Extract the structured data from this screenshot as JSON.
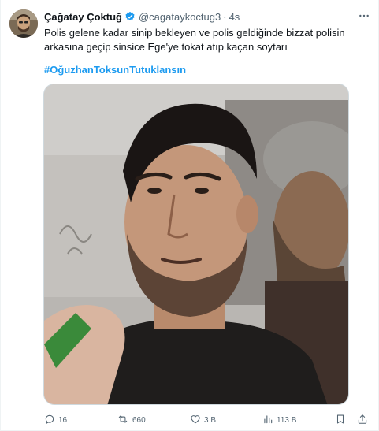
{
  "tweet": {
    "author_name": "Çağatay Çoktuğ",
    "handle": "@cagataykoctug3",
    "separator": "·",
    "time": "4s",
    "text": "Polis gelene kadar sinip bekleyen ve polis geldiğinde bizzat polisin arkasına geçip sinsice Ege'ye tokat atıp kaçan soytarı",
    "hashtag": "#OğuzhanToksunTutuklansın"
  },
  "actions": {
    "replies": "16",
    "retweets": "660",
    "likes": "3 B",
    "views": "113 B"
  },
  "icons": {
    "verified": "verified-badge-icon",
    "more": "more-dots-icon",
    "reply": "reply-icon",
    "retweet": "retweet-icon",
    "like": "heart-icon",
    "views": "views-bars-icon",
    "bookmark": "bookmark-icon",
    "share": "share-icon"
  },
  "colors": {
    "accent": "#1d9bf0",
    "muted": "#536471",
    "text": "#0f1419"
  }
}
